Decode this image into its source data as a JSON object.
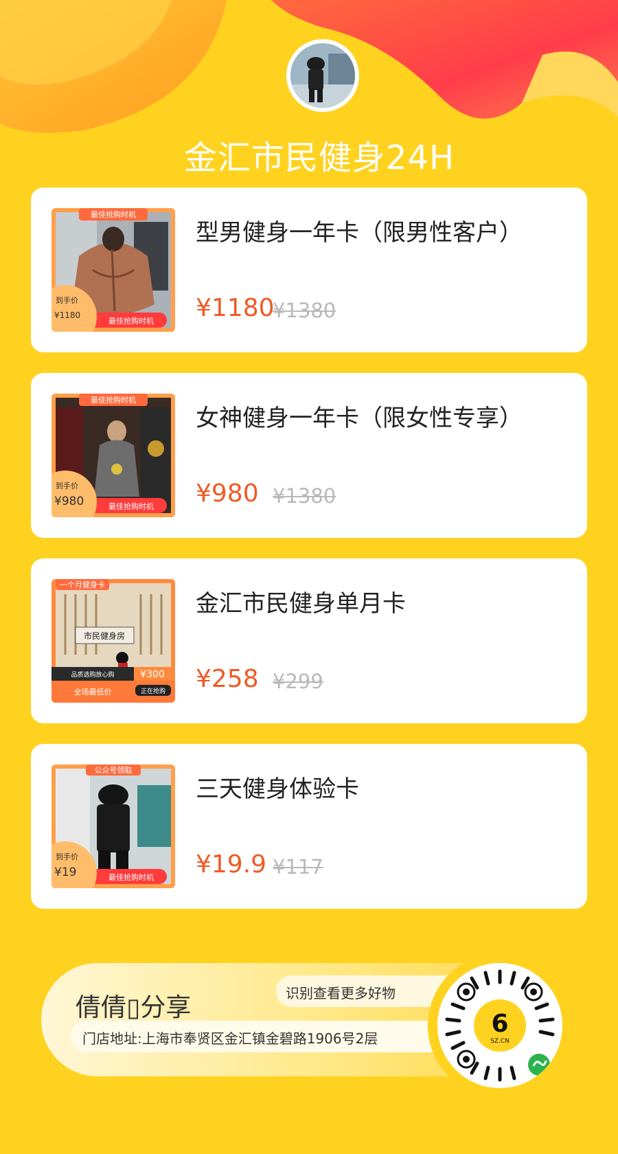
{
  "shop": {
    "title": "金汇市民健身24H"
  },
  "products": [
    {
      "name": "型男健身一年卡（限男性客户）",
      "price": "¥1180",
      "original_price": "¥1380",
      "badge_top": "最佳抢购时机",
      "badge_corner_label": "到手价",
      "badge_corner_price": "¥1180",
      "badge_bottom": "最佳抢购时机"
    },
    {
      "name": "女神健身一年卡（限女性专享）",
      "price": "¥980",
      "original_price": "¥1380",
      "badge_top": "最佳抢购时机",
      "badge_corner_label": "到手价",
      "badge_corner_price": "¥980",
      "badge_bottom": "最佳抢购时机"
    },
    {
      "name": "金汇市民健身单月卡",
      "price": "¥258",
      "original_price": "¥299",
      "badge_top": "一个月健身卡",
      "badge_caption": "品质选购放心购",
      "badge_price": "¥300",
      "badge_bottom": "全场最低价",
      "badge_status": "正在抢购",
      "sign_text": "市民健身房"
    },
    {
      "name": "三天健身体验卡",
      "price": "¥19.9",
      "original_price": "¥117",
      "badge_top": "公众号领取",
      "badge_corner_label": "到手价",
      "badge_corner_price": "¥19",
      "badge_bottom": "最佳抢购时机"
    }
  ],
  "footer": {
    "author": "倩倩▯分享",
    "cta": "识别查看更多好物",
    "address": "门店地址:上海市奉贤区金汇镇金碧路1906号2层",
    "qr_logo_text": "SZ.CN"
  },
  "colors": {
    "background": "#ffd21f",
    "price": "#f05a24",
    "card": "#ffffff",
    "accent_red": "#ff3b3b"
  }
}
